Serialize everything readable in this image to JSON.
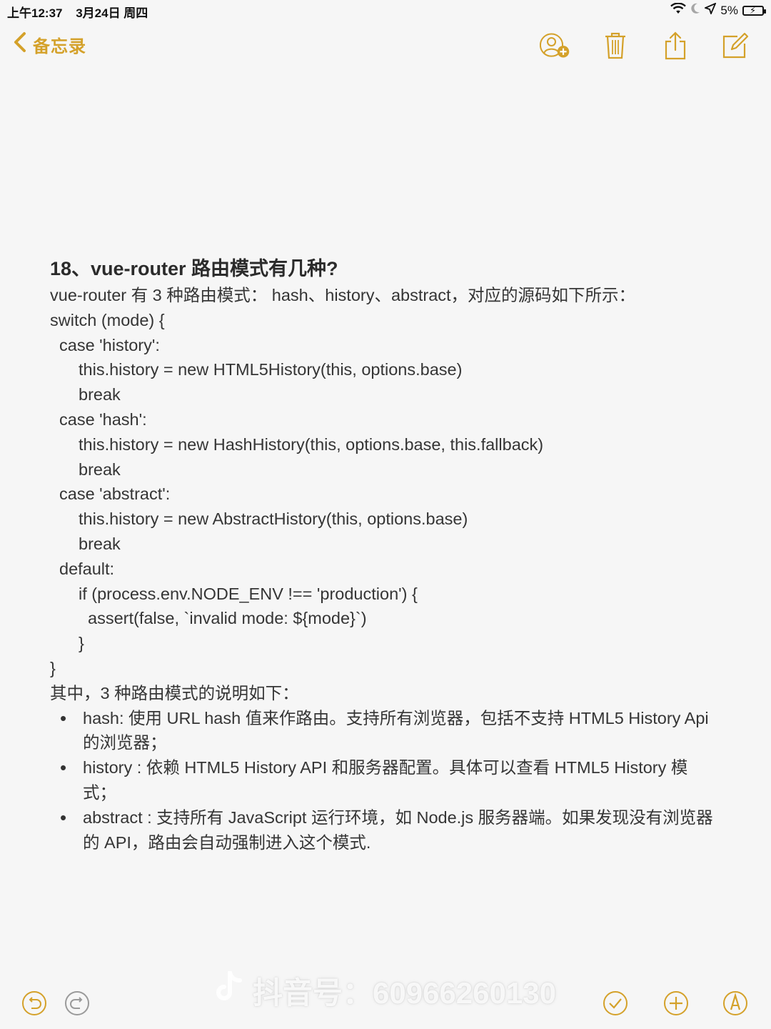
{
  "status_bar": {
    "time": "上午12:37",
    "date": "3月24日 周四",
    "battery": "5%",
    "wifi_icon": "wifi-icon",
    "moon_icon": "moon-icon",
    "location_icon": "location-icon"
  },
  "nav": {
    "back_label": "备忘录",
    "accent": "#d4a12a",
    "icons": [
      "add-person-icon",
      "trash-icon",
      "share-icon",
      "compose-icon"
    ]
  },
  "note": {
    "title": "18、vue-router 路由模式有几种?",
    "intro": "vue-router 有 3 种路由模式： hash、history、abstract，对应的源码如下所示：",
    "code": [
      {
        "text": "switch (mode) {",
        "indent": 0
      },
      {
        "text": "case 'history':",
        "indent": 1
      },
      {
        "text": "this.history = new HTML5History(this, options.base)",
        "indent": 2
      },
      {
        "text": "break",
        "indent": 2
      },
      {
        "text": "case 'hash':",
        "indent": 1
      },
      {
        "text": "this.history = new HashHistory(this, options.base, this.fallback)",
        "indent": 2
      },
      {
        "text": "break",
        "indent": 2
      },
      {
        "text": "case 'abstract':",
        "indent": 1
      },
      {
        "text": "this.history = new AbstractHistory(this, options.base)",
        "indent": 2
      },
      {
        "text": "break",
        "indent": 2
      },
      {
        "text": "default:",
        "indent": 1
      },
      {
        "text": "if (process.env.NODE_ENV !== 'production') {",
        "indent": 2
      },
      {
        "text": "assert(false, `invalid mode: ${mode}`)",
        "indent": 3
      },
      {
        "text": "}",
        "indent": 2
      },
      {
        "text": "}",
        "indent": 0
      }
    ],
    "summary_intro": "其中，3 种路由模式的说明如下：",
    "bullets": [
      "hash: 使用 URL hash 值来作路由。支持所有浏览器，包括不支持 HTML5 History Api 的浏览器；",
      "history : 依赖 HTML5 History API 和服务器配置。具体可以查看 HTML5 History 模式；",
      "abstract : 支持所有 JavaScript 运行环境，如 Node.js 服务器端。如果发现没有浏览器的 API，路由会自动强制进入这个模式."
    ]
  },
  "watermark": {
    "text": "抖音号：60966260130",
    "logo_icon": "tiktok-logo-icon"
  },
  "bottom_bar": {
    "icons": [
      "undo-icon",
      "redo-icon",
      "checklist-icon",
      "add-icon",
      "markup-icon"
    ]
  }
}
